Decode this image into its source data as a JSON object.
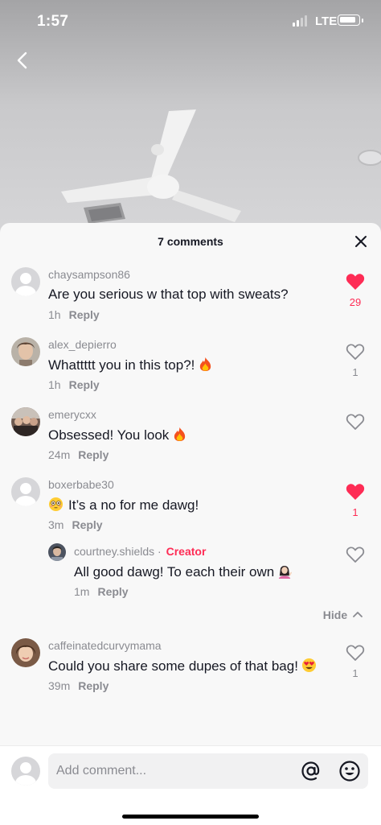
{
  "status": {
    "time": "1:57",
    "network": "LTE"
  },
  "sheet": {
    "title": "7 comments"
  },
  "comments": [
    {
      "user": "chaysampson86",
      "text": "Are you serious w that top with sweats?",
      "time": "1h",
      "reply": "Reply",
      "likes": "29",
      "liked": true,
      "avatar": "default-avatar"
    },
    {
      "user": "alex_depierro",
      "text": "Whattttt you in this top?!",
      "time": "1h",
      "reply": "Reply",
      "likes": "1",
      "liked": false,
      "avatar": "photo-avatar"
    },
    {
      "user": "emerycxx",
      "text": "Obsessed! You look",
      "time": "24m",
      "reply": "Reply",
      "likes": "",
      "liked": false,
      "avatar": "photo-avatar"
    },
    {
      "user": "boxerbabe30",
      "text": "It’s a no for me dawg!",
      "time": "3m",
      "reply": "Reply",
      "likes": "1",
      "liked": true,
      "avatar": "default-avatar"
    },
    {
      "user": "courtney.shields",
      "badge": "Creator",
      "text": "All good dawg! To each their own",
      "time": "1m",
      "reply": "Reply",
      "likes": "",
      "liked": false,
      "avatar": "photo-avatar"
    },
    {
      "user": "caffeinatedcurvymama",
      "text": "Could you share some dupes of that bag!",
      "time": "39m",
      "reply": "Reply",
      "likes": "1",
      "liked": false,
      "avatar": "photo-avatar"
    }
  ],
  "hide_label": "Hide",
  "input": {
    "placeholder": "Add comment..."
  },
  "icons": [
    "back-icon",
    "close-icon",
    "heart-icon",
    "at-icon",
    "emoji-icon",
    "fire-emoji",
    "flushed-emoji",
    "person-tipping-hand-emoji",
    "heart-eyes-emoji"
  ],
  "colors": {
    "like_red": "#fe2c55",
    "muted": "#8a8b91",
    "text": "#161823"
  }
}
